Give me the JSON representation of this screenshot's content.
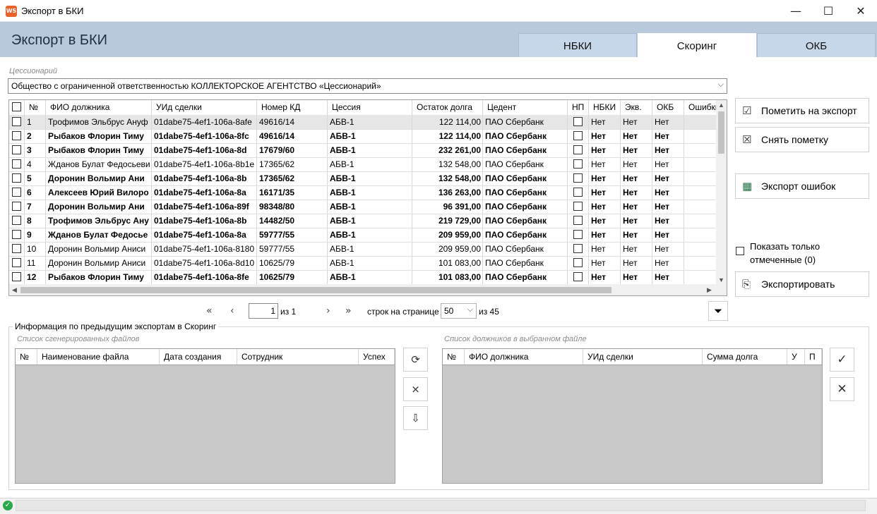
{
  "window": {
    "icon_text": "WS",
    "title": "Экспорт в БКИ",
    "minimize": "—",
    "maximize": "☐",
    "close": "✕"
  },
  "page_title": "Экспорт в БКИ",
  "tabs": [
    {
      "label": "НБКИ",
      "active": false
    },
    {
      "label": "Скоринг",
      "active": true
    },
    {
      "label": "ОКБ",
      "active": false
    }
  ],
  "cessionary": {
    "label": "Цессионарий",
    "value": "Общество с ограниченной ответственностью КОЛЛЕКТОРСКОЕ АГЕНТСТВО «Цессионарий»"
  },
  "grid": {
    "columns": [
      "№",
      "ФИО должника",
      "УИд сделки",
      "Номер КД",
      "Цессия",
      "Остаток долга",
      "Цедент",
      "НП",
      "НБКИ",
      "Экв.",
      "ОКБ",
      "Ошибки"
    ],
    "rows": [
      {
        "n": "1",
        "fio": "Трофимов Эльбрус Ануф",
        "uid": "01dabe75-4ef1-106a-8afe",
        "kd": "49616/14",
        "cession": "АБВ-1",
        "debt": "122 114,00",
        "cedent": "ПАО Сбербанк",
        "nbki": "Нет",
        "ekv": "Нет",
        "okb": "Нет",
        "bold": false,
        "selected": true
      },
      {
        "n": "2",
        "fio": "Рыбаков Флорин Тиму",
        "uid": "01dabe75-4ef1-106a-8fc",
        "kd": "49616/14",
        "cession": "АБВ-1",
        "debt": "122 114,00",
        "cedent": "ПАО Сбербанк",
        "nbki": "Нет",
        "ekv": "Нет",
        "okb": "Нет",
        "bold": true,
        "selected": false
      },
      {
        "n": "3",
        "fio": "Рыбаков Флорин Тиму",
        "uid": "01dabe75-4ef1-106a-8d",
        "kd": "17679/60",
        "cession": "АБВ-1",
        "debt": "232 261,00",
        "cedent": "ПАО Сбербанк",
        "nbki": "Нет",
        "ekv": "Нет",
        "okb": "Нет",
        "bold": true,
        "selected": false
      },
      {
        "n": "4",
        "fio": "Жданов Булат Федосьеви",
        "uid": "01dabe75-4ef1-106a-8b1e",
        "kd": "17365/62",
        "cession": "АБВ-1",
        "debt": "132 548,00",
        "cedent": "ПАО Сбербанк",
        "nbki": "Нет",
        "ekv": "Нет",
        "okb": "Нет",
        "bold": false,
        "selected": false
      },
      {
        "n": "5",
        "fio": "Доронин Вольмир Ани",
        "uid": "01dabe75-4ef1-106a-8b",
        "kd": "17365/62",
        "cession": "АБВ-1",
        "debt": "132 548,00",
        "cedent": "ПАО Сбербанк",
        "nbki": "Нет",
        "ekv": "Нет",
        "okb": "Нет",
        "bold": true,
        "selected": false
      },
      {
        "n": "6",
        "fio": "Алексеев Юрий Вилоро",
        "uid": "01dabe75-4ef1-106a-8a",
        "kd": "16171/35",
        "cession": "АБВ-1",
        "debt": "136 263,00",
        "cedent": "ПАО Сбербанк",
        "nbki": "Нет",
        "ekv": "Нет",
        "okb": "Нет",
        "bold": true,
        "selected": false
      },
      {
        "n": "7",
        "fio": "Доронин Вольмир Ани",
        "uid": "01dabe75-4ef1-106a-89f",
        "kd": "98348/80",
        "cession": "АБВ-1",
        "debt": "96 391,00",
        "cedent": "ПАО Сбербанк",
        "nbki": "Нет",
        "ekv": "Нет",
        "okb": "Нет",
        "bold": true,
        "selected": false
      },
      {
        "n": "8",
        "fio": "Трофимов Эльбрус Ану",
        "uid": "01dabe75-4ef1-106a-8b",
        "kd": "14482/50",
        "cession": "АБВ-1",
        "debt": "219 729,00",
        "cedent": "ПАО Сбербанк",
        "nbki": "Нет",
        "ekv": "Нет",
        "okb": "Нет",
        "bold": true,
        "selected": false
      },
      {
        "n": "9",
        "fio": "Жданов Булат Федосье",
        "uid": "01dabe75-4ef1-106a-8a",
        "kd": "59777/55",
        "cession": "АБВ-1",
        "debt": "209 959,00",
        "cedent": "ПАО Сбербанк",
        "nbki": "Нет",
        "ekv": "Нет",
        "okb": "Нет",
        "bold": true,
        "selected": false
      },
      {
        "n": "10",
        "fio": "Доронин Вольмир Аниси",
        "uid": "01dabe75-4ef1-106a-8180",
        "kd": "59777/55",
        "cession": "АБВ-1",
        "debt": "209 959,00",
        "cedent": "ПАО Сбербанк",
        "nbki": "Нет",
        "ekv": "Нет",
        "okb": "Нет",
        "bold": false,
        "selected": false
      },
      {
        "n": "11",
        "fio": "Доронин Вольмир Аниси",
        "uid": "01dabe75-4ef1-106a-8d10",
        "kd": "10625/79",
        "cession": "АБВ-1",
        "debt": "101 083,00",
        "cedent": "ПАО Сбербанк",
        "nbki": "Нет",
        "ekv": "Нет",
        "okb": "Нет",
        "bold": false,
        "selected": false
      },
      {
        "n": "12",
        "fio": "Рыбаков Флорин Тиму",
        "uid": "01dabe75-4ef1-106a-8fe",
        "kd": "10625/79",
        "cession": "АБВ-1",
        "debt": "101 083,00",
        "cedent": "ПАО Сбербанк",
        "nbki": "Нет",
        "ekv": "Нет",
        "okb": "Нет",
        "bold": true,
        "selected": false
      }
    ]
  },
  "actions": {
    "mark_export": "Пометить на экспорт",
    "unmark": "Снять пометку",
    "export_errors": "Экспорт ошибок",
    "show_only_marked": "Показать только отмеченные (0)",
    "export": "Экспортировать"
  },
  "pager": {
    "first": "«",
    "prev": "‹",
    "page": "1",
    "of_pages": "из 1",
    "next": "›",
    "last": "»",
    "rows_label": "строк на странице",
    "rows_per_page": "50",
    "total": "из 45"
  },
  "history": {
    "title": "Информация по предыдущим экспортам в Скоринг",
    "files_label": "Список сгенерированных файлов",
    "files_columns": [
      "№",
      "Наименование файла",
      "Дата создания",
      "Сотрудник",
      "Успех"
    ],
    "debtors_label": "Список должников в выбранном файле",
    "debtors_columns": [
      "№",
      "ФИО должника",
      "УИд сделки",
      "Сумма долга",
      "У",
      "П"
    ]
  },
  "icons": {
    "filter": "filter-add-icon",
    "status": "check-circle-icon"
  },
  "colors": {
    "header_band": "#b9c9dc",
    "tab_inactive": "#c6d7ea",
    "status_ok": "#2aa84a"
  }
}
